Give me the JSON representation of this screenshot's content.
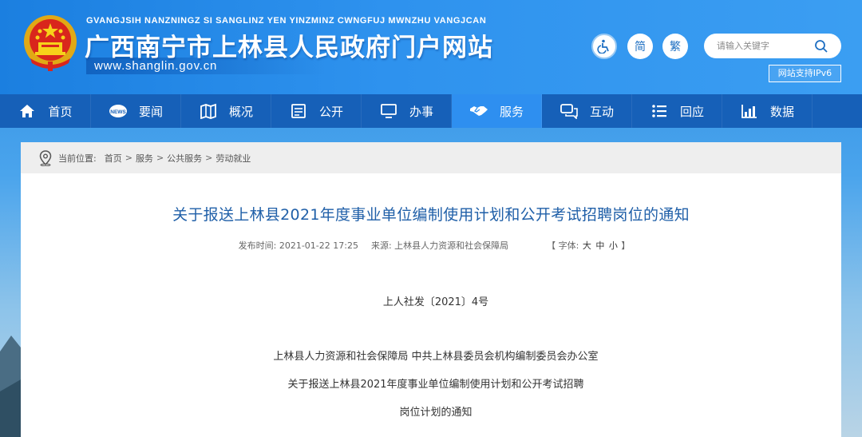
{
  "header": {
    "pinyin": "GVANGJSIH NANZNINGZ SI SANGLINZ YEN YINZMINZ CWNGFUJ MWNZHU VANGJCAN",
    "title": "广西南宁市上林县人民政府门户网站",
    "url": "www.shanglin.gov.cn",
    "accessibility_icon": "wheelchair-icon",
    "simplified_label": "简",
    "traditional_label": "繁",
    "search_placeholder": "请输入关键字",
    "ipv6_label": "网站支持IPv6"
  },
  "nav": {
    "items": [
      {
        "label": "首页",
        "icon": "home-icon"
      },
      {
        "label": "要闻",
        "icon": "news-icon"
      },
      {
        "label": "概况",
        "icon": "map-icon"
      },
      {
        "label": "公开",
        "icon": "document-icon"
      },
      {
        "label": "办事",
        "icon": "monitor-icon"
      },
      {
        "label": "服务",
        "icon": "handshake-icon"
      },
      {
        "label": "互动",
        "icon": "chat-icon"
      },
      {
        "label": "回应",
        "icon": "list-icon"
      },
      {
        "label": "数据",
        "icon": "bar-chart-icon"
      }
    ],
    "active_index": 5
  },
  "breadcrumb": {
    "prefix": "当前位置:",
    "items": [
      "首页",
      "服务",
      "公共服务",
      "劳动就业"
    ]
  },
  "article": {
    "title": "关于报送上林县2021年度事业单位编制使用计划和公开考试招聘岗位的通知",
    "publish_time": "发布时间:  2021-01-22 17:25",
    "source": "来源:  上林县人力资源和社会保障局",
    "font_size_label": "【 字体: ",
    "font_large": "大",
    "font_medium": "中",
    "font_small": "小",
    "font_size_close": " 】",
    "doc_number": "上人社发〔2021〕4号",
    "issuers": "上林县人力资源和社会保障局  中共上林县委员会机构编制委员会办公室",
    "body_title_line1": "关于报送上林县2021年度事业单位编制使用计划和公开考试招聘",
    "body_title_line2": "岗位计划的通知"
  },
  "colors": {
    "header_blue": "#2e92ee",
    "nav_blue": "#1660b8",
    "nav_active": "#2e8ff0",
    "title_blue": "#1f5fa8"
  }
}
